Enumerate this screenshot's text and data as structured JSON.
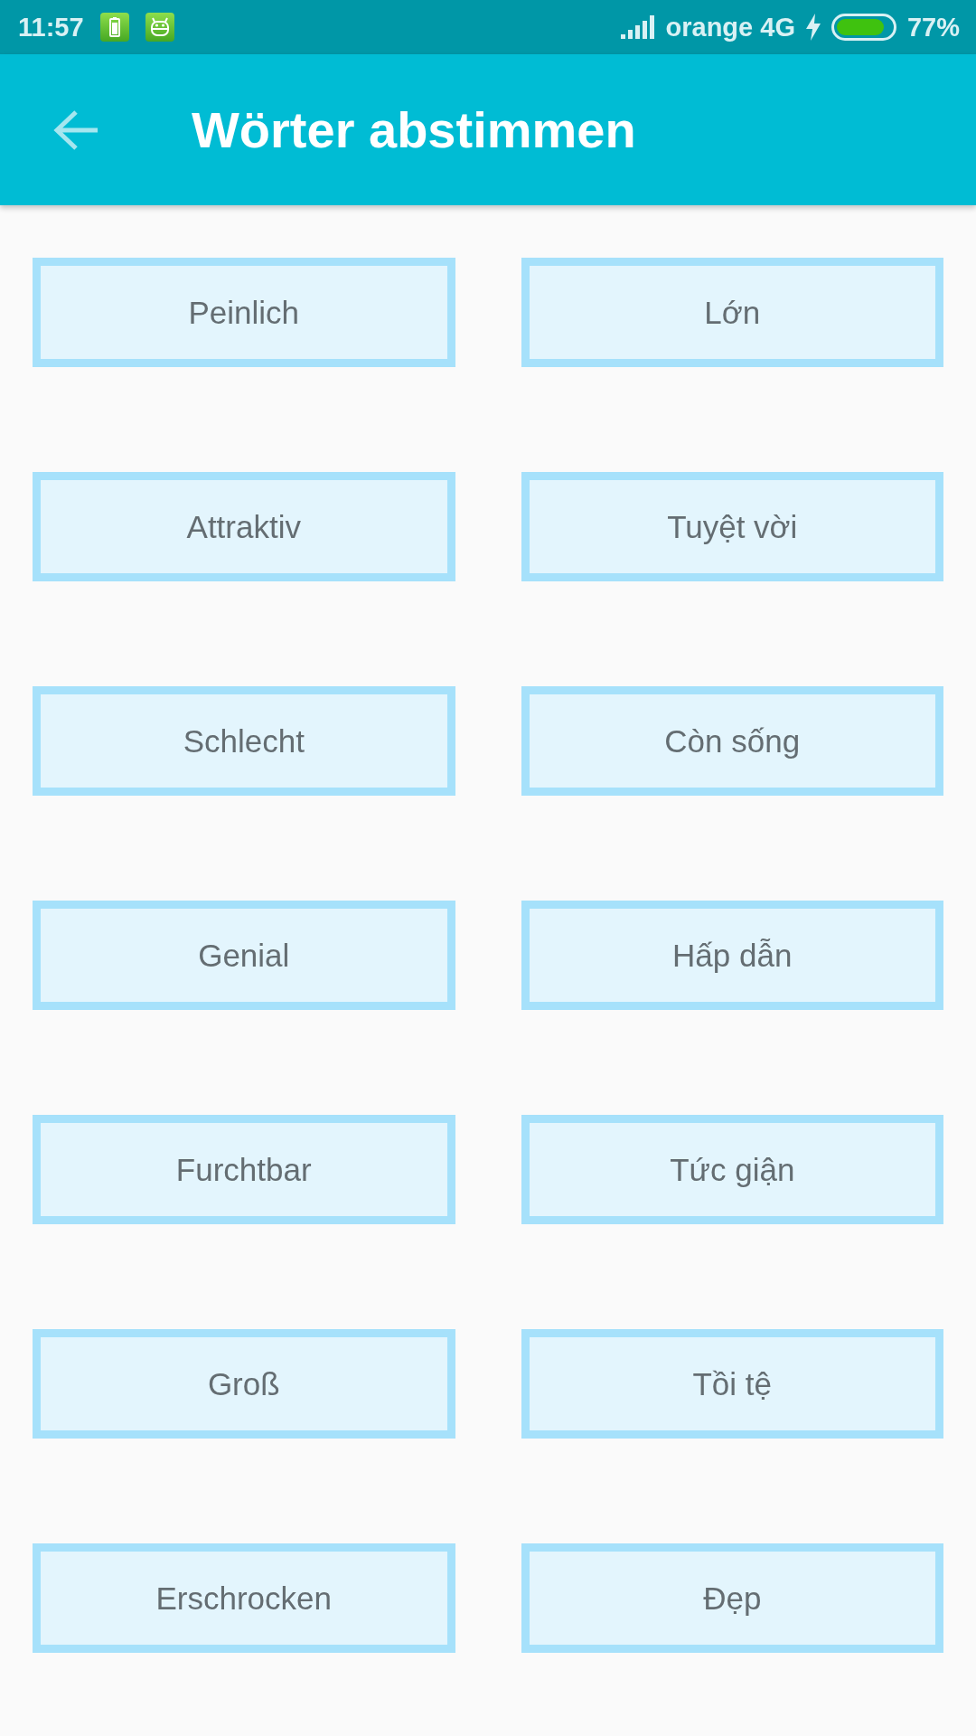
{
  "status_bar": {
    "time": "11:57",
    "carrier": "orange 4G",
    "battery": "77%"
  },
  "app_bar": {
    "title": "Wörter abstimmen"
  },
  "cards": [
    {
      "label": "Peinlich"
    },
    {
      "label": "Lớn"
    },
    {
      "label": "Attraktiv"
    },
    {
      "label": "Tuyệt vời"
    },
    {
      "label": "Schlecht"
    },
    {
      "label": "Còn sống"
    },
    {
      "label": "Genial"
    },
    {
      "label": "Hấp dẫn"
    },
    {
      "label": "Furchtbar"
    },
    {
      "label": "Tức giận"
    },
    {
      "label": "Groß"
    },
    {
      "label": "Tồi tệ"
    },
    {
      "label": "Erschrocken"
    },
    {
      "label": "Đẹp"
    }
  ]
}
